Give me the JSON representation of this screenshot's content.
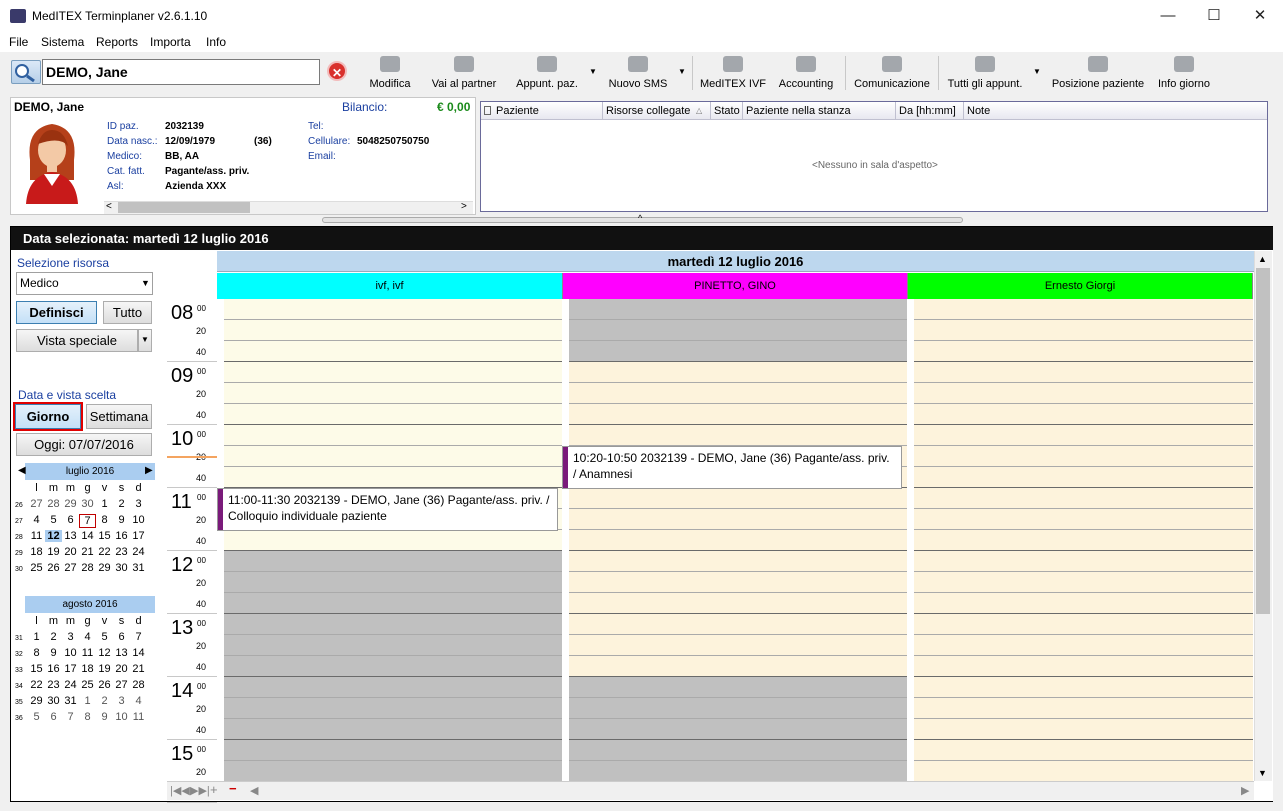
{
  "window": {
    "title": "MedITEX Terminplaner  v2.6.1.10",
    "minimize": "—",
    "maximize": "☐",
    "close": "✕"
  },
  "menu": [
    "File",
    "Sistema",
    "Reports",
    "Importa",
    "Info"
  ],
  "search": {
    "value": "DEMO, Jane",
    "clear": "✕"
  },
  "toolbar": [
    {
      "label": "Modifica",
      "icon": "edit-icon"
    },
    {
      "label": "Vai al partner",
      "icon": "partner-icon"
    },
    {
      "label": "Appunt. paz.",
      "icon": "appointments-icon"
    },
    {
      "label": "Nuovo SMS",
      "icon": "sms-icon"
    },
    {
      "label": "MedITEX IVF",
      "icon": "ivf-icon"
    },
    {
      "label": "Accounting",
      "icon": "accounting-icon"
    },
    {
      "label": "Comunicazione",
      "icon": "communication-icon"
    },
    {
      "label": "Tutti gli appunt.",
      "icon": "all-appointments-icon"
    },
    {
      "label": "Posizione paziente",
      "icon": "position-icon"
    },
    {
      "label": "Info giorno",
      "icon": "day-info-icon"
    }
  ],
  "patient": {
    "name": "DEMO, Jane",
    "balance_label": "Bilancio:",
    "balance": "€ 0,00",
    "fields": [
      {
        "label": "ID paz.",
        "value": "2032139"
      },
      {
        "label": "Data nasc.:",
        "value": "12/09/1979",
        "extra": "(36)"
      },
      {
        "label": "Medico:",
        "value": "BB, AA"
      },
      {
        "label": "Cat. fatt.",
        "value": "Pagante/ass. priv."
      },
      {
        "label": "Asl:",
        "value": "Azienda XXX"
      }
    ],
    "contact": [
      {
        "label": "Tel:",
        "value": ""
      },
      {
        "label": "Cellulare:",
        "value": "5048250750750"
      },
      {
        "label": "Email:",
        "value": ""
      }
    ]
  },
  "waiting": {
    "columns": [
      "Paziente",
      "Risorse collegate",
      "Stato",
      "Paziente nella stanza",
      "Da [hh:mm]",
      "Note"
    ],
    "empty": "<Nessuno in sala d'aspetto>"
  },
  "date_bar": "Data selezionata:  martedì 12 luglio 2016",
  "left": {
    "resource_label": "Selezione risorsa",
    "resource_value": "Medico",
    "define": "Definisci",
    "all": "Tutto",
    "special_view": "Vista speciale",
    "view_label": "Data e vista scelta",
    "day": "Giorno",
    "week": "Settimana",
    "today": "Oggi: 07/07/2016"
  },
  "calendars": [
    {
      "month": "luglio 2016",
      "dow": [
        "l",
        "m",
        "m",
        "g",
        "v",
        "s",
        "d"
      ],
      "weeks": [
        {
          "wk": "26",
          "days": [
            "27",
            "28",
            "29",
            "30",
            "1",
            "2",
            "3"
          ]
        },
        {
          "wk": "27",
          "days": [
            "4",
            "5",
            "6",
            "7",
            "8",
            "9",
            "10"
          ]
        },
        {
          "wk": "28",
          "days": [
            "11",
            "12",
            "13",
            "14",
            "15",
            "16",
            "17"
          ]
        },
        {
          "wk": "29",
          "days": [
            "18",
            "19",
            "20",
            "21",
            "22",
            "23",
            "24"
          ]
        },
        {
          "wk": "30",
          "days": [
            "25",
            "26",
            "27",
            "28",
            "29",
            "30",
            "31"
          ]
        }
      ]
    },
    {
      "month": "agosto 2016",
      "dow": [
        "l",
        "m",
        "m",
        "g",
        "v",
        "s",
        "d"
      ],
      "weeks": [
        {
          "wk": "31",
          "days": [
            "1",
            "2",
            "3",
            "4",
            "5",
            "6",
            "7"
          ]
        },
        {
          "wk": "32",
          "days": [
            "8",
            "9",
            "10",
            "11",
            "12",
            "13",
            "14"
          ]
        },
        {
          "wk": "33",
          "days": [
            "15",
            "16",
            "17",
            "18",
            "19",
            "20",
            "21"
          ]
        },
        {
          "wk": "34",
          "days": [
            "22",
            "23",
            "24",
            "25",
            "26",
            "27",
            "28"
          ]
        },
        {
          "wk": "35",
          "days": [
            "29",
            "30",
            "31",
            "1",
            "2",
            "3",
            "4"
          ]
        },
        {
          "wk": "36",
          "days": [
            "5",
            "6",
            "7",
            "8",
            "9",
            "10",
            "11"
          ]
        }
      ]
    }
  ],
  "schedule": {
    "day_title": "martedì 12 luglio 2016",
    "resources": [
      {
        "name": "ivf, ivf",
        "color": "#00ffff"
      },
      {
        "name": "PINETTO, GINO",
        "color": "#ff00ff"
      },
      {
        "name": "Ernesto Giorgi",
        "color": "#00ff00"
      }
    ],
    "hours": [
      "08",
      "09",
      "10",
      "11",
      "12",
      "13",
      "14",
      "15"
    ],
    "minute_labels": [
      "00",
      "20",
      "40"
    ],
    "appointments": [
      {
        "text": "10:20-10:50 2032139 - DEMO, Jane (36) Pagante/ass. priv. / Anamnesi"
      },
      {
        "text": "11:00-11:30 2032139 - DEMO, Jane (36) Pagante/ass. priv. / Colloquio individuale paziente"
      }
    ]
  },
  "colors": {
    "free": "#fdfbe8",
    "free2": "#fdf3dc",
    "blocked": "#c0c0c0",
    "appt_bar": "#7a1a7a"
  }
}
